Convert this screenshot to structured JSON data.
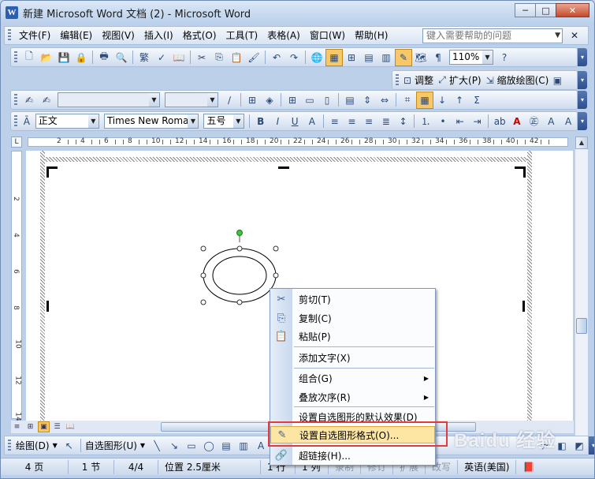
{
  "window": {
    "title": "新建 Microsoft Word 文档 (2) - Microsoft Word",
    "app_icon_letter": "W",
    "controls": {
      "minimize": "─",
      "maximize": "□",
      "close": "✕"
    }
  },
  "menubar": {
    "items": [
      "文件(F)",
      "编辑(E)",
      "视图(V)",
      "插入(I)",
      "格式(O)",
      "工具(T)",
      "表格(A)",
      "窗口(W)",
      "帮助(H)"
    ],
    "help_placeholder": "键入需要帮助的问题",
    "doc_close": "✕"
  },
  "toolbar_standard": {
    "zoom": "110%"
  },
  "toolbar_picture": {
    "buttons": [
      "调整",
      "扩大(P)",
      "缩放绘图(C)"
    ]
  },
  "toolbar_format": {
    "style": "正文",
    "font": "Times New Roman",
    "size": "五号"
  },
  "ruler": {
    "h_numbers": [
      "2",
      "4",
      "6",
      "8",
      "10",
      "12",
      "14",
      "16",
      "18",
      "20",
      "22",
      "24",
      "26",
      "28",
      "30",
      "32",
      "34",
      "36",
      "38",
      "40",
      "42"
    ],
    "v_numbers": [
      "2",
      "4",
      "6",
      "8",
      "10",
      "12",
      "14"
    ]
  },
  "context_menu": {
    "items": [
      {
        "label": "剪切(T)",
        "icon": "✂"
      },
      {
        "label": "复制(C)",
        "icon": "⎘"
      },
      {
        "label": "粘贴(P)",
        "icon": "📋"
      },
      {
        "label": "添加文字(X)",
        "icon": ""
      },
      {
        "label": "组合(G)",
        "icon": "",
        "submenu": true
      },
      {
        "label": "叠放次序(R)",
        "icon": "",
        "submenu": true
      },
      {
        "label": "设置自选图形的默认效果(D)",
        "icon": ""
      },
      {
        "label": "设置自选图形格式(O)...",
        "icon": "✎"
      },
      {
        "label": "超链接(H)...",
        "icon": "🔗"
      }
    ]
  },
  "drawbar": {
    "draw_label": "绘图(D)",
    "autoshapes_label": "自选图形(U)"
  },
  "statusbar": {
    "page": "4 页",
    "section": "1 节",
    "page_count": "4/4",
    "position": "位置 2.5厘米",
    "line": "1 行",
    "col": "1 列",
    "rec": "录制",
    "trk": "修订",
    "ext": "扩展",
    "ovr": "改写",
    "language": "英语(美国)"
  },
  "watermark": "Baidu 经验"
}
